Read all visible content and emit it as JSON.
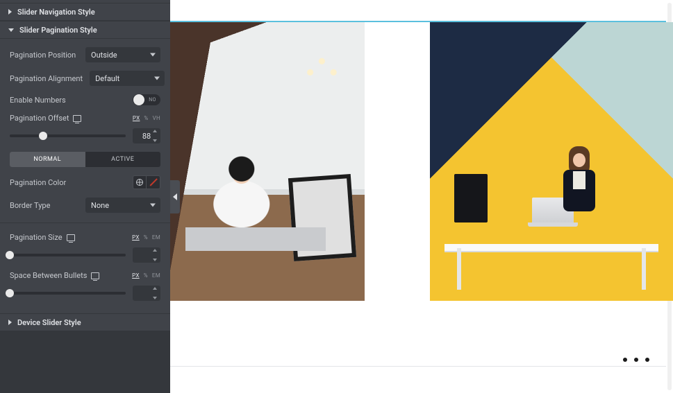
{
  "sidebar": {
    "nav_style_section": {
      "title": "Slider Navigation Style",
      "expanded": false
    },
    "pagination_style_section": {
      "title": "Slider Pagination Style",
      "expanded": true
    },
    "device_slider_style_section": {
      "title": "Device Slider Style",
      "expanded": false
    },
    "pagination_position": {
      "label": "Pagination Position",
      "value": "Outside"
    },
    "pagination_alignment": {
      "label": "Pagination Alignment",
      "value": "Default"
    },
    "enable_numbers": {
      "label": "Enable Numbers",
      "value": false,
      "off_text": "NO"
    },
    "pagination_offset": {
      "label": "Pagination Offset",
      "units": [
        "PX",
        "%",
        "VH"
      ],
      "active_unit": "PX",
      "value": "88",
      "min": 0,
      "max": 300,
      "percent": 29
    },
    "state_tabs": {
      "options": [
        "NORMAL",
        "ACTIVE"
      ],
      "active": "NORMAL"
    },
    "pagination_color": {
      "label": "Pagination Color",
      "value_type": "global",
      "swatch": "none"
    },
    "border_type": {
      "label": "Border Type",
      "value": "None"
    },
    "pagination_size": {
      "label": "Pagination Size",
      "units": [
        "PX",
        "%",
        "EM"
      ],
      "active_unit": "PX",
      "value": "",
      "percent": 0
    },
    "space_between_bullets": {
      "label": "Space Between Bullets",
      "units": [
        "PX",
        "%",
        "EM"
      ],
      "active_unit": "PX",
      "value": "",
      "percent": 0
    }
  },
  "canvas": {
    "selection": "slider-widget",
    "pagination": {
      "dots": 3,
      "active_index": 0
    }
  },
  "icons": {
    "chevron_down": "chevron-down-icon",
    "caret_right": "caret-right-icon",
    "caret_down": "caret-down-icon",
    "responsive": "responsive-icon",
    "globe": "globe-icon",
    "none_slash": "none-slash-icon",
    "collapse_left": "collapse-left-icon"
  }
}
